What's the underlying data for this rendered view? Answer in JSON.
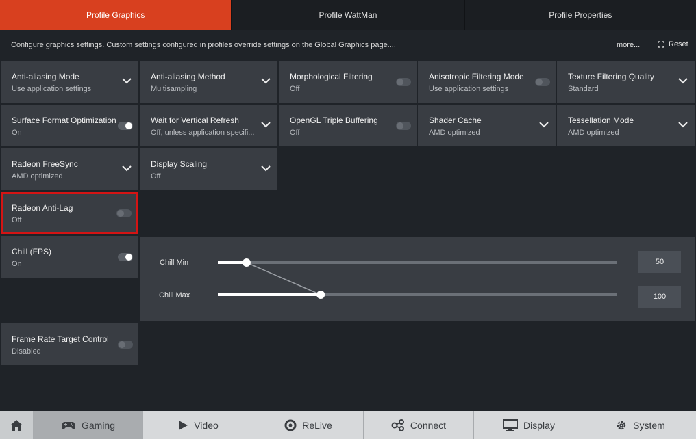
{
  "tabs": [
    {
      "label": "Profile Graphics",
      "active": true
    },
    {
      "label": "Profile WattMan",
      "active": false
    },
    {
      "label": "Profile Properties",
      "active": false
    }
  ],
  "info": {
    "description": "Configure graphics settings. Custom settings configured in profiles override settings on the Global Graphics page....",
    "more_label": "more...",
    "reset_label": "Reset"
  },
  "tiles": [
    {
      "title": "Anti-aliasing Mode",
      "value": "Use application settings",
      "control": "dropdown"
    },
    {
      "title": "Anti-aliasing Method",
      "value": "Multisampling",
      "control": "dropdown"
    },
    {
      "title": "Morphological Filtering",
      "value": "Off",
      "control": "toggle-off"
    },
    {
      "title": "Anisotropic Filtering Mode",
      "value": "Use application settings",
      "control": "toggle-off"
    },
    {
      "title": "Texture Filtering Quality",
      "value": "Standard",
      "control": "dropdown"
    },
    {
      "title": "Surface Format Optimization",
      "value": "On",
      "control": "toggle-on"
    },
    {
      "title": "Wait for Vertical Refresh",
      "value": "Off, unless application specifi...",
      "control": "dropdown"
    },
    {
      "title": "OpenGL Triple Buffering",
      "value": "Off",
      "control": "toggle-off"
    },
    {
      "title": "Shader Cache",
      "value": "AMD optimized",
      "control": "dropdown"
    },
    {
      "title": "Tessellation Mode",
      "value": "AMD optimized",
      "control": "dropdown"
    },
    {
      "title": "Radeon FreeSync",
      "value": "AMD optimized",
      "control": "dropdown"
    },
    {
      "title": "Display Scaling",
      "value": "Off",
      "control": "dropdown"
    },
    {
      "title": "Radeon Anti-Lag",
      "value": "Off",
      "control": "toggle-off"
    },
    {
      "title": "Chill (FPS)",
      "value": "On",
      "control": "toggle-on"
    },
    {
      "title": "Frame Rate Target Control",
      "value": "Disabled",
      "control": "toggle-off"
    }
  ],
  "chill": {
    "min_label": "Chill Min",
    "max_label": "Chill Max",
    "min_value": "50",
    "max_value": "100",
    "min_fraction": 0.072,
    "max_fraction": 0.258
  },
  "bottom_nav": [
    {
      "label": "",
      "icon": "home-icon"
    },
    {
      "label": "Gaming",
      "icon": "gamepad-icon",
      "active": true
    },
    {
      "label": "Video",
      "icon": "play-icon"
    },
    {
      "label": "ReLive",
      "icon": "relive-icon"
    },
    {
      "label": "Connect",
      "icon": "connect-icon"
    },
    {
      "label": "Display",
      "icon": "monitor-icon"
    },
    {
      "label": "System",
      "icon": "gear-icon"
    }
  ],
  "colors": {
    "accent": "#d8401f",
    "tile": "#393d43",
    "background": "#1f2328",
    "highlight": "#d41414"
  }
}
